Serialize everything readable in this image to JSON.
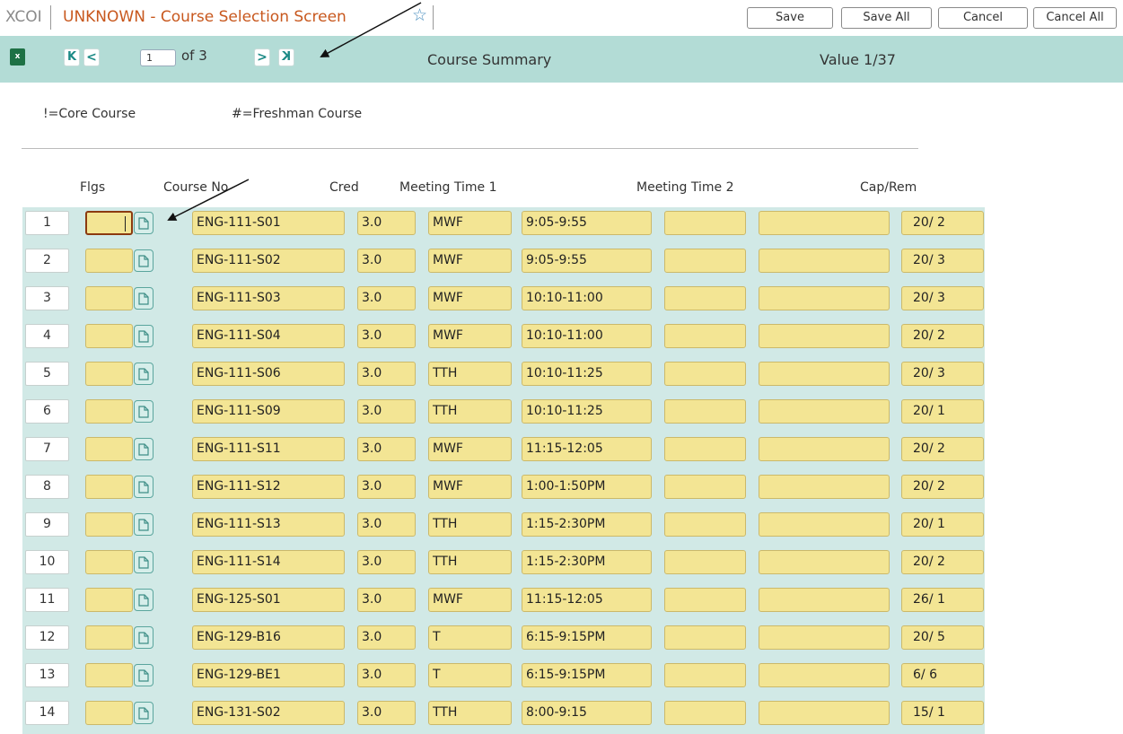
{
  "titlebar": {
    "app_code": "XCOI",
    "screen_title": "UNKNOWN - Course Selection Screen",
    "star_glyph": "☆",
    "buttons": {
      "save": "Save",
      "save_all": "Save All",
      "cancel": "Cancel",
      "cancel_all": "Cancel All"
    }
  },
  "toolbar": {
    "excel_label": "x",
    "first_glyph": "K",
    "prev_glyph": "<",
    "next_glyph": ">",
    "last_glyph": "K",
    "page_value": "1",
    "page_of": "of 3",
    "title": "Course Summary",
    "value_label": "Value 1/37"
  },
  "legend": {
    "core": "!=Core Course",
    "freshman": "#=Freshman Course"
  },
  "headers": {
    "flags": "Flgs",
    "course_no": "Course No",
    "cred": "Cred",
    "meeting_time_1": "Meeting Time 1",
    "meeting_time_2": "Meeting Time 2",
    "cap_rem": "Cap/Rem"
  },
  "rows": [
    {
      "num": "1",
      "course": "ENG-111-S01",
      "cred": "3.0",
      "days": "MWF",
      "time": "9:05-9:55",
      "cap": "20/ 2"
    },
    {
      "num": "2",
      "course": "ENG-111-S02",
      "cred": "3.0",
      "days": "MWF",
      "time": "9:05-9:55",
      "cap": "20/ 3"
    },
    {
      "num": "3",
      "course": "ENG-111-S03",
      "cred": "3.0",
      "days": "MWF",
      "time": "10:10-11:00",
      "cap": "20/ 3"
    },
    {
      "num": "4",
      "course": "ENG-111-S04",
      "cred": "3.0",
      "days": "MWF",
      "time": "10:10-11:00",
      "cap": "20/ 2"
    },
    {
      "num": "5",
      "course": "ENG-111-S06",
      "cred": "3.0",
      "days": "TTH",
      "time": "10:10-11:25",
      "cap": "20/ 3"
    },
    {
      "num": "6",
      "course": "ENG-111-S09",
      "cred": "3.0",
      "days": "TTH",
      "time": "10:10-11:25",
      "cap": "20/ 1"
    },
    {
      "num": "7",
      "course": "ENG-111-S11",
      "cred": "3.0",
      "days": "MWF",
      "time": "11:15-12:05",
      "cap": "20/ 2"
    },
    {
      "num": "8",
      "course": "ENG-111-S12",
      "cred": "3.0",
      "days": "MWF",
      "time": "1:00-1:50PM",
      "cap": "20/ 2"
    },
    {
      "num": "9",
      "course": "ENG-111-S13",
      "cred": "3.0",
      "days": "TTH",
      "time": "1:15-2:30PM",
      "cap": "20/ 1"
    },
    {
      "num": "10",
      "course": "ENG-111-S14",
      "cred": "3.0",
      "days": "TTH",
      "time": "1:15-2:30PM",
      "cap": "20/ 2"
    },
    {
      "num": "11",
      "course": "ENG-125-S01",
      "cred": "3.0",
      "days": "MWF",
      "time": "11:15-12:05",
      "cap": "26/ 1"
    },
    {
      "num": "12",
      "course": "ENG-129-B16",
      "cred": "3.0",
      "days": "T",
      "time": "6:15-9:15PM",
      "cap": "20/ 5"
    },
    {
      "num": "13",
      "course": "ENG-129-BE1",
      "cred": "3.0",
      "days": "T",
      "time": "6:15-9:15PM",
      "cap": "6/ 6"
    },
    {
      "num": "14",
      "course": "ENG-131-S02",
      "cred": "3.0",
      "days": "TTH",
      "time": "8:00-9:15",
      "cap": "15/ 1"
    }
  ],
  "colors": {
    "title_orange": "#c8581e",
    "toolbar_teal": "#b3dcd6",
    "grid_bg": "#d1e9e6",
    "field_yellow": "#f3e594",
    "nav_teal": "#1c8a86"
  }
}
